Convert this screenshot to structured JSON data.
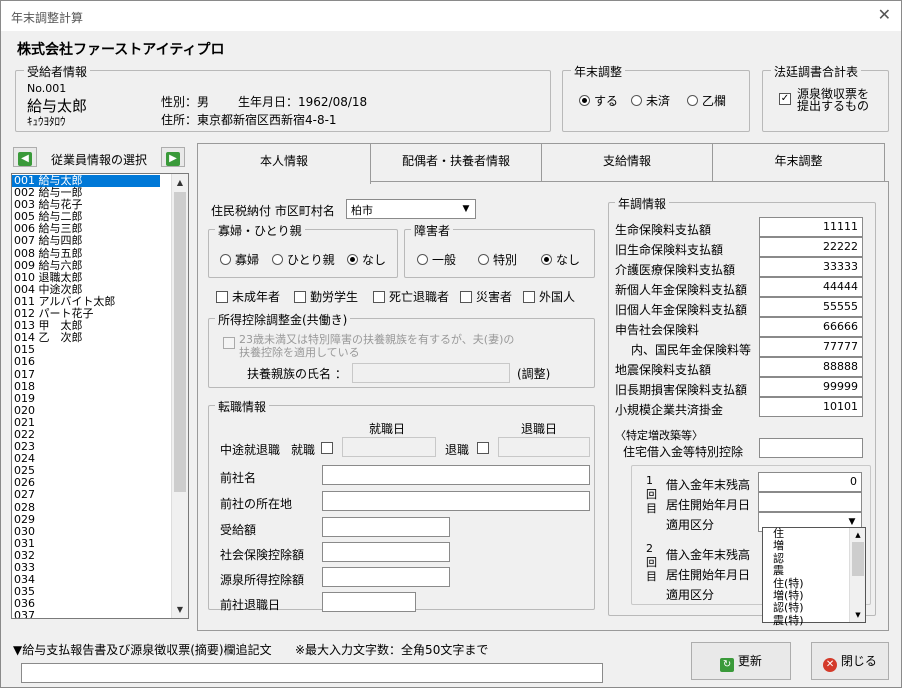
{
  "window": {
    "title": "年末調整計算"
  },
  "company": "株式会社ファーストアイティプロ",
  "recipient": {
    "legend": "受給者情報",
    "no": "No.001",
    "name": "給与太郎",
    "kana": "ｷｭｳﾖﾀﾛｳ",
    "gender_label": "性別：男",
    "birth_label": "生年月日：1962/08/18",
    "address_label": "住所：東京都新宿区西新宿4-8-1"
  },
  "year_end": {
    "legend": "年末調整",
    "options": [
      "する",
      "未済",
      "乙欄"
    ],
    "selected": 0
  },
  "legal": {
    "legend": "法廷調書合計表",
    "checkbox_label_1": "源泉徴収票を",
    "checkbox_label_2": "提出するもの",
    "checked": true
  },
  "employee_select": {
    "label": "従業員情報の選択",
    "prev": "◀",
    "next": "▶"
  },
  "employees": [
    "001 給与太郎",
    "002 給与一郎",
    "003 給与花子",
    "005 給与二郎",
    "006 給与三郎",
    "007 給与四郎",
    "008 給与五郎",
    "009 給与六郎",
    "010 退職太郎",
    "004 中途次郎",
    "011 アルバイト太郎",
    "012 パート花子",
    "013 甲　太郎",
    "014 乙　次郎",
    "015",
    "016",
    "017",
    "018",
    "019",
    "020",
    "021",
    "022",
    "023",
    "024",
    "025",
    "026",
    "027",
    "028",
    "029",
    "030",
    "031",
    "032",
    "033",
    "034",
    "035",
    "036",
    "037"
  ],
  "tabs": [
    "本人情報",
    "配偶者・扶養者情報",
    "支給情報",
    "年末調整"
  ],
  "resident_tax": {
    "label": "住民税納付 市区町村名",
    "value": "柏市"
  },
  "widow": {
    "legend": "寡婦・ひとり親",
    "options": [
      "寡婦",
      "ひとり親",
      "なし"
    ],
    "selected": 2
  },
  "disabled": {
    "legend": "障害者",
    "options": [
      "一般",
      "特別",
      "なし"
    ],
    "selected": 2
  },
  "flags": [
    "未成年者",
    "勤労学生",
    "死亡退職者",
    "災害者",
    "外国人"
  ],
  "income_adj": {
    "legend": "所得控除調整金(共働き)",
    "note_1": "23歳未満又は特別障害の扶養親族を有するが、夫(妻)の",
    "note_2": "扶養控除を適用している",
    "name_label": "扶養親族の氏名 ：",
    "suffix": "(調整)"
  },
  "job_change": {
    "legend": "転職情報",
    "hire_date_header": "就職日",
    "leave_date_header": "退職日",
    "midway_label": "中途就退職",
    "hire_label": "就職",
    "leave_label": "退職",
    "fields": [
      "前社名",
      "前社の所在地",
      "受給額",
      "社会保険控除額",
      "源泉所得控除額",
      "前社退職日"
    ]
  },
  "annual": {
    "legend": "年調情報",
    "rows": [
      {
        "label": "生命保険料支払額",
        "value": "11111"
      },
      {
        "label": "旧生命保険料支払額",
        "value": "22222"
      },
      {
        "label": "介護医療保険料支払額",
        "value": "33333"
      },
      {
        "label": "新個人年金保険料支払額",
        "value": "44444"
      },
      {
        "label": "旧個人年金保険料支払額",
        "value": "55555"
      },
      {
        "label": "申告社会保険料",
        "value": "66666"
      },
      {
        "label": "内、国民年金保険料等",
        "value": "77777"
      },
      {
        "label": "地震保険料支払額",
        "value": "88888"
      },
      {
        "label": "旧長期損害保険料支払額",
        "value": "99999"
      },
      {
        "label": "小規模企業共済掛金",
        "value": "10101"
      }
    ],
    "special_header": "〈特定増改築等〉",
    "housing_label": "住宅借入金等特別控除",
    "first_label": "1回目",
    "second_label": "2回目",
    "loan_balance_label": "借入金年末残高",
    "loan_balance_value": "0",
    "residence_start_label": "居住開始年月日",
    "category_label": "適用区分"
  },
  "popup_options": [
    "住",
    "増",
    "認",
    "震",
    "住(特)",
    "増(特)",
    "認(特)",
    "震(特)"
  ],
  "footer": {
    "memo_label": "▼給与支払報告書及び源泉徴収票(摘要)欄追記文",
    "max_label": "※最大入力文字数：全角50文字まで",
    "refresh": "更新",
    "close": "閉じる"
  }
}
